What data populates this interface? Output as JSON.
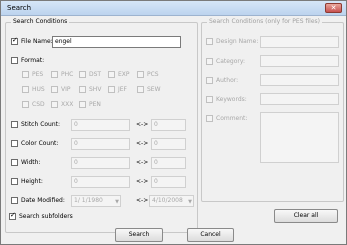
{
  "window": {
    "title": "Search",
    "close_glyph": "✕"
  },
  "left_group": {
    "title": "Search Conditions",
    "file_name": {
      "label": "File Name:",
      "checked": true,
      "value": "engel"
    },
    "format": {
      "label": "Format:",
      "types": [
        "PES",
        "PHC",
        "DST",
        "EXP",
        "PCS",
        "HUS",
        "VIP",
        "SHV",
        "JEF",
        "SEW",
        "CSD",
        "XXX",
        "PEN"
      ]
    },
    "stitch_count": {
      "label": "Stitch Count:",
      "from": "0",
      "to": "0"
    },
    "color_count": {
      "label": "Color Count:",
      "from": "0",
      "to": "0"
    },
    "width": {
      "label": "Width:",
      "from": "0",
      "to": "0"
    },
    "height": {
      "label": "Height:",
      "from": "0",
      "to": "0"
    },
    "date_modified": {
      "label": "Date Modified:",
      "from": "1/ 1/1980",
      "to": "4/10/2008"
    },
    "range_sep": "<->"
  },
  "right_group": {
    "title": "Search Conditions (only for PES files)",
    "fields": [
      "Design Name:",
      "Category:",
      "Author:",
      "Keywords:",
      "Comment:"
    ]
  },
  "search_subfolders": {
    "label": "Search subfolders",
    "checked": true
  },
  "buttons": {
    "clear_all": "Clear all",
    "search": "Search",
    "cancel": "Cancel"
  }
}
